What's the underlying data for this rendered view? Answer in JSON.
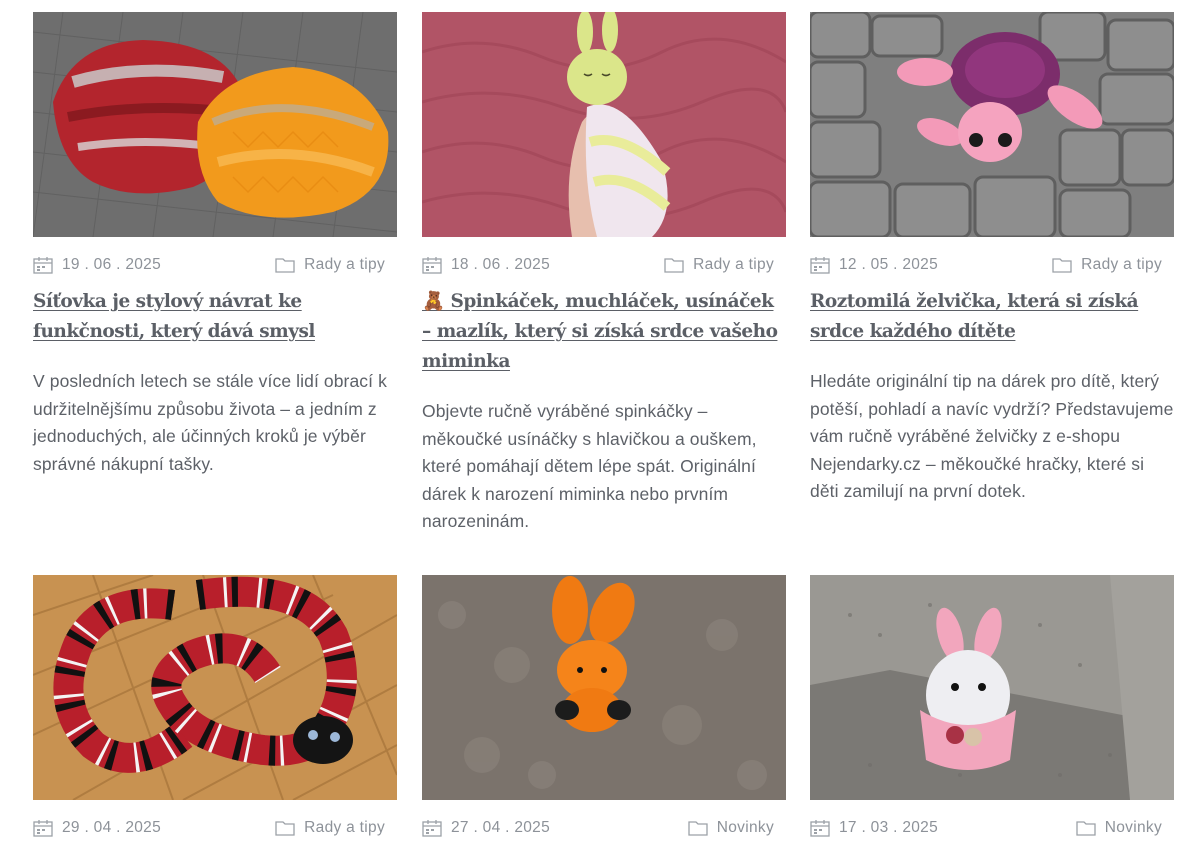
{
  "posts": [
    {
      "date": "19 . 06 . 2025",
      "category": "Rady a tipy",
      "title": "Síťovka je stylový návrat ke funkčnosti, který dává smysl",
      "excerpt": "V posledních letech se stále více lidí obrací k udržitelnějšímu způsobu života – a jedním z jednoduchých, ale účinných kroků je výběr správné nákupní tašky.",
      "image_subject": "crocheted-net-bags"
    },
    {
      "date": "18 . 06 . 2025",
      "category": "Rady a tipy",
      "title": "🧸 Spinkáček, muchláček, usínáček – mazlík, který si získá srdce vašeho miminka",
      "excerpt": "Objevte ručně vyráběné spinkáčky – měkoučké usínáčky s hlavičkou a ouškem, které pomáhají dětem lépe spát. Originální dárek k narození miminka nebo prvním narozeninám.",
      "image_subject": "bunny-comforter"
    },
    {
      "date": "12 . 05 . 2025",
      "category": "Rady a tipy",
      "title": "Roztomilá želvička, která si získá srdce každého dítěte",
      "excerpt": "Hledáte originální tip na dárek pro dítě, který potěší, pohladí a navíc vydrží? Představujeme vám ručně vyráběné želvičky z e-shopu Nejendarky.cz – měkoučké hračky, které si děti zamilují na první dotek.",
      "image_subject": "pink-turtle-toy"
    },
    {
      "date": "29 . 04 . 2025",
      "category": "Rady a tipy",
      "title": "",
      "excerpt": "",
      "image_subject": "crocheted-snake"
    },
    {
      "date": "27 . 04 . 2025",
      "category": "Novinky",
      "title": "",
      "excerpt": "",
      "image_subject": "orange-bunny"
    },
    {
      "date": "17 . 03 . 2025",
      "category": "Novinky",
      "title": "",
      "excerpt": "",
      "image_subject": "bunny-egg"
    }
  ],
  "colors": {
    "text": "#5d6168",
    "meta": "#8d9299",
    "title": "#5b5f66"
  },
  "icons": {
    "date": "calendar-icon",
    "category": "folder-icon"
  }
}
